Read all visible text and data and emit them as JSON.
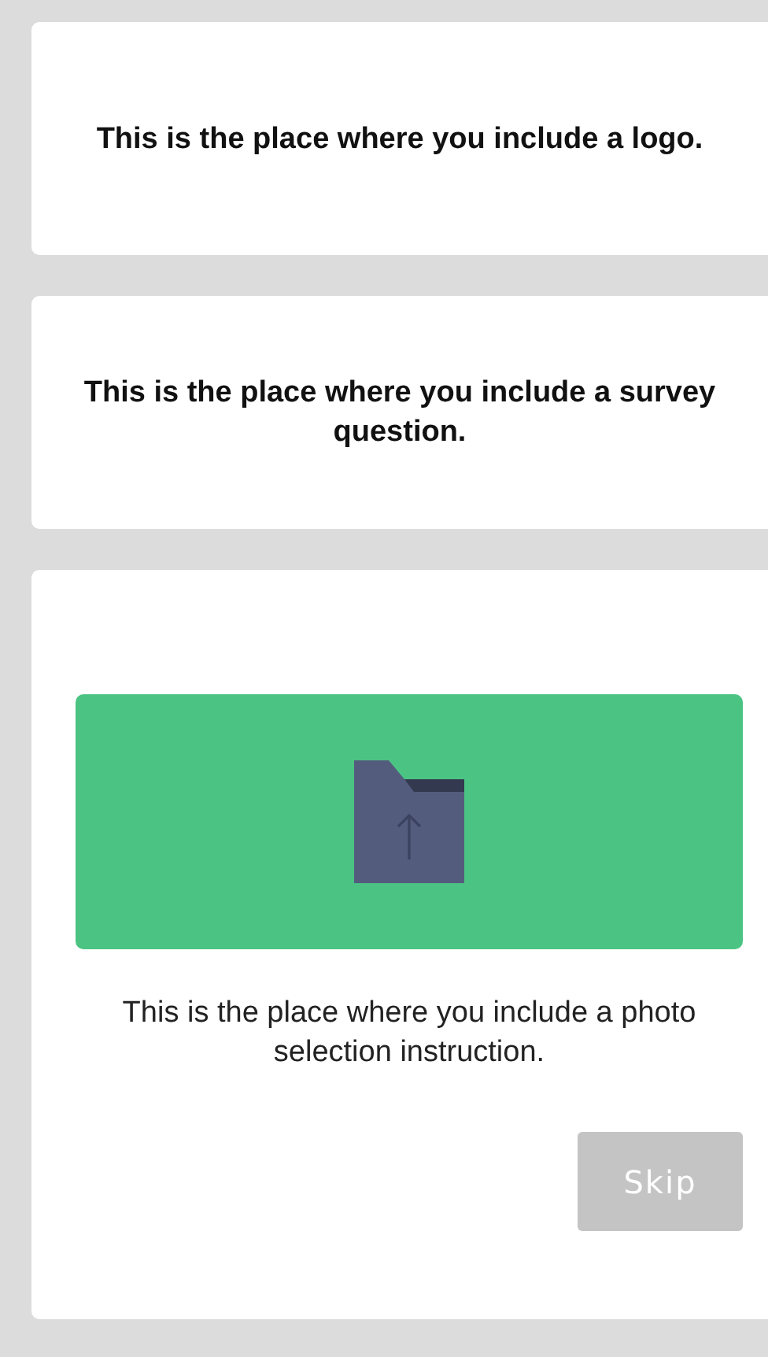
{
  "logo_card": {
    "text": "This is the place where you include a logo."
  },
  "question_card": {
    "text": "This is the place where you include a survey question."
  },
  "photo_card": {
    "instruction": "This is the place where you include a photo selection instruction.",
    "skip_button": {
      "label": "Skip",
      "disabled": true
    }
  }
}
